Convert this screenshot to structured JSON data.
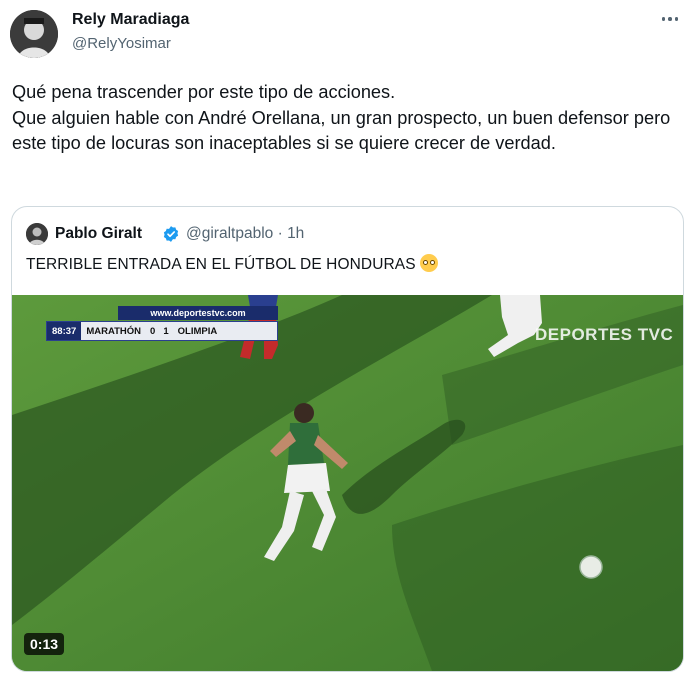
{
  "tweet": {
    "author_name": "Rely Maradiaga",
    "author_handle": "@RelyYosimar",
    "more_icon": "more-horizontal-icon",
    "text": "Qué  pena trascender por este tipo de acciones.\nQue alguien hable con André Orellana, un gran prospecto, un buen defensor pero este tipo de locuras son inaceptables si se quiere crecer de verdad."
  },
  "quoted_tweet": {
    "author_name": "Pablo Giralt",
    "verified_icon": "verified-badge-icon",
    "author_handle": "@giraltpablo",
    "separator": "·",
    "time": "1h",
    "text": "TERRIBLE ENTRADA EN EL FÚTBOL DE HONDURAS",
    "emoji": "flushed-face-emoji",
    "video": {
      "duration": "0:13",
      "scoreboard": {
        "url": "www.deportestvc.com",
        "clock": "88:37",
        "home_team": "MARATHÓN",
        "home_score": "0",
        "away_score": "1",
        "away_team": "OLIMPIA"
      },
      "broadcaster": "DEPORTES TVC"
    }
  },
  "colors": {
    "text_primary": "#0f1419",
    "text_secondary": "#536471",
    "border": "#cfd9de",
    "verified_blue": "#1d9bf0",
    "pitch_green": "#4f8a34"
  }
}
